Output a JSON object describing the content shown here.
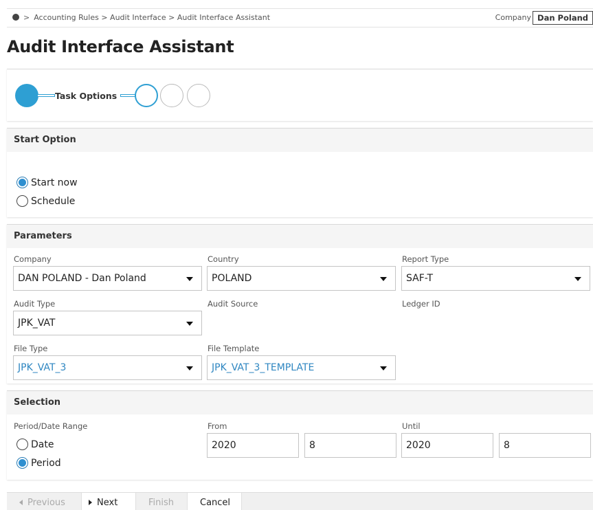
{
  "breadcrumb": {
    "items": [
      "Accounting Rules",
      "Audit Interface",
      "Audit Interface Assistant"
    ],
    "separator": ">"
  },
  "header": {
    "company_label": "Company",
    "company_value": "Dan Poland"
  },
  "page_title": "Audit Interface Assistant",
  "stepper": {
    "current_step_label": "Task Options",
    "total_steps": 4,
    "accent_color": "#2e9fd3"
  },
  "start_option": {
    "title": "Start Option",
    "options": [
      {
        "label": "Start now",
        "selected": true
      },
      {
        "label": "Schedule",
        "selected": false
      }
    ]
  },
  "parameters": {
    "title": "Parameters",
    "company": {
      "label": "Company",
      "value": "DAN POLAND - Dan Poland"
    },
    "country": {
      "label": "Country",
      "value": "POLAND"
    },
    "report_type": {
      "label": "Report Type",
      "value": "SAF-T"
    },
    "audit_type": {
      "label": "Audit Type",
      "value": "JPK_VAT"
    },
    "audit_source": {
      "label": "Audit Source"
    },
    "ledger_id": {
      "label": "Ledger ID"
    },
    "file_type": {
      "label": "File Type",
      "value": "JPK_VAT_3"
    },
    "file_template": {
      "label": "File Template",
      "value": "JPK_VAT_3_TEMPLATE"
    }
  },
  "selection": {
    "title": "Selection",
    "range_label": "Period/Date Range",
    "range_options": [
      {
        "label": "Date",
        "selected": false
      },
      {
        "label": "Period",
        "selected": true
      }
    ],
    "from": {
      "label": "From",
      "year": "2020",
      "period": "8"
    },
    "until": {
      "label": "Until",
      "year": "2020",
      "period": "8"
    }
  },
  "footer": {
    "previous": "Previous",
    "next": "Next",
    "finish": "Finish",
    "cancel": "Cancel"
  }
}
